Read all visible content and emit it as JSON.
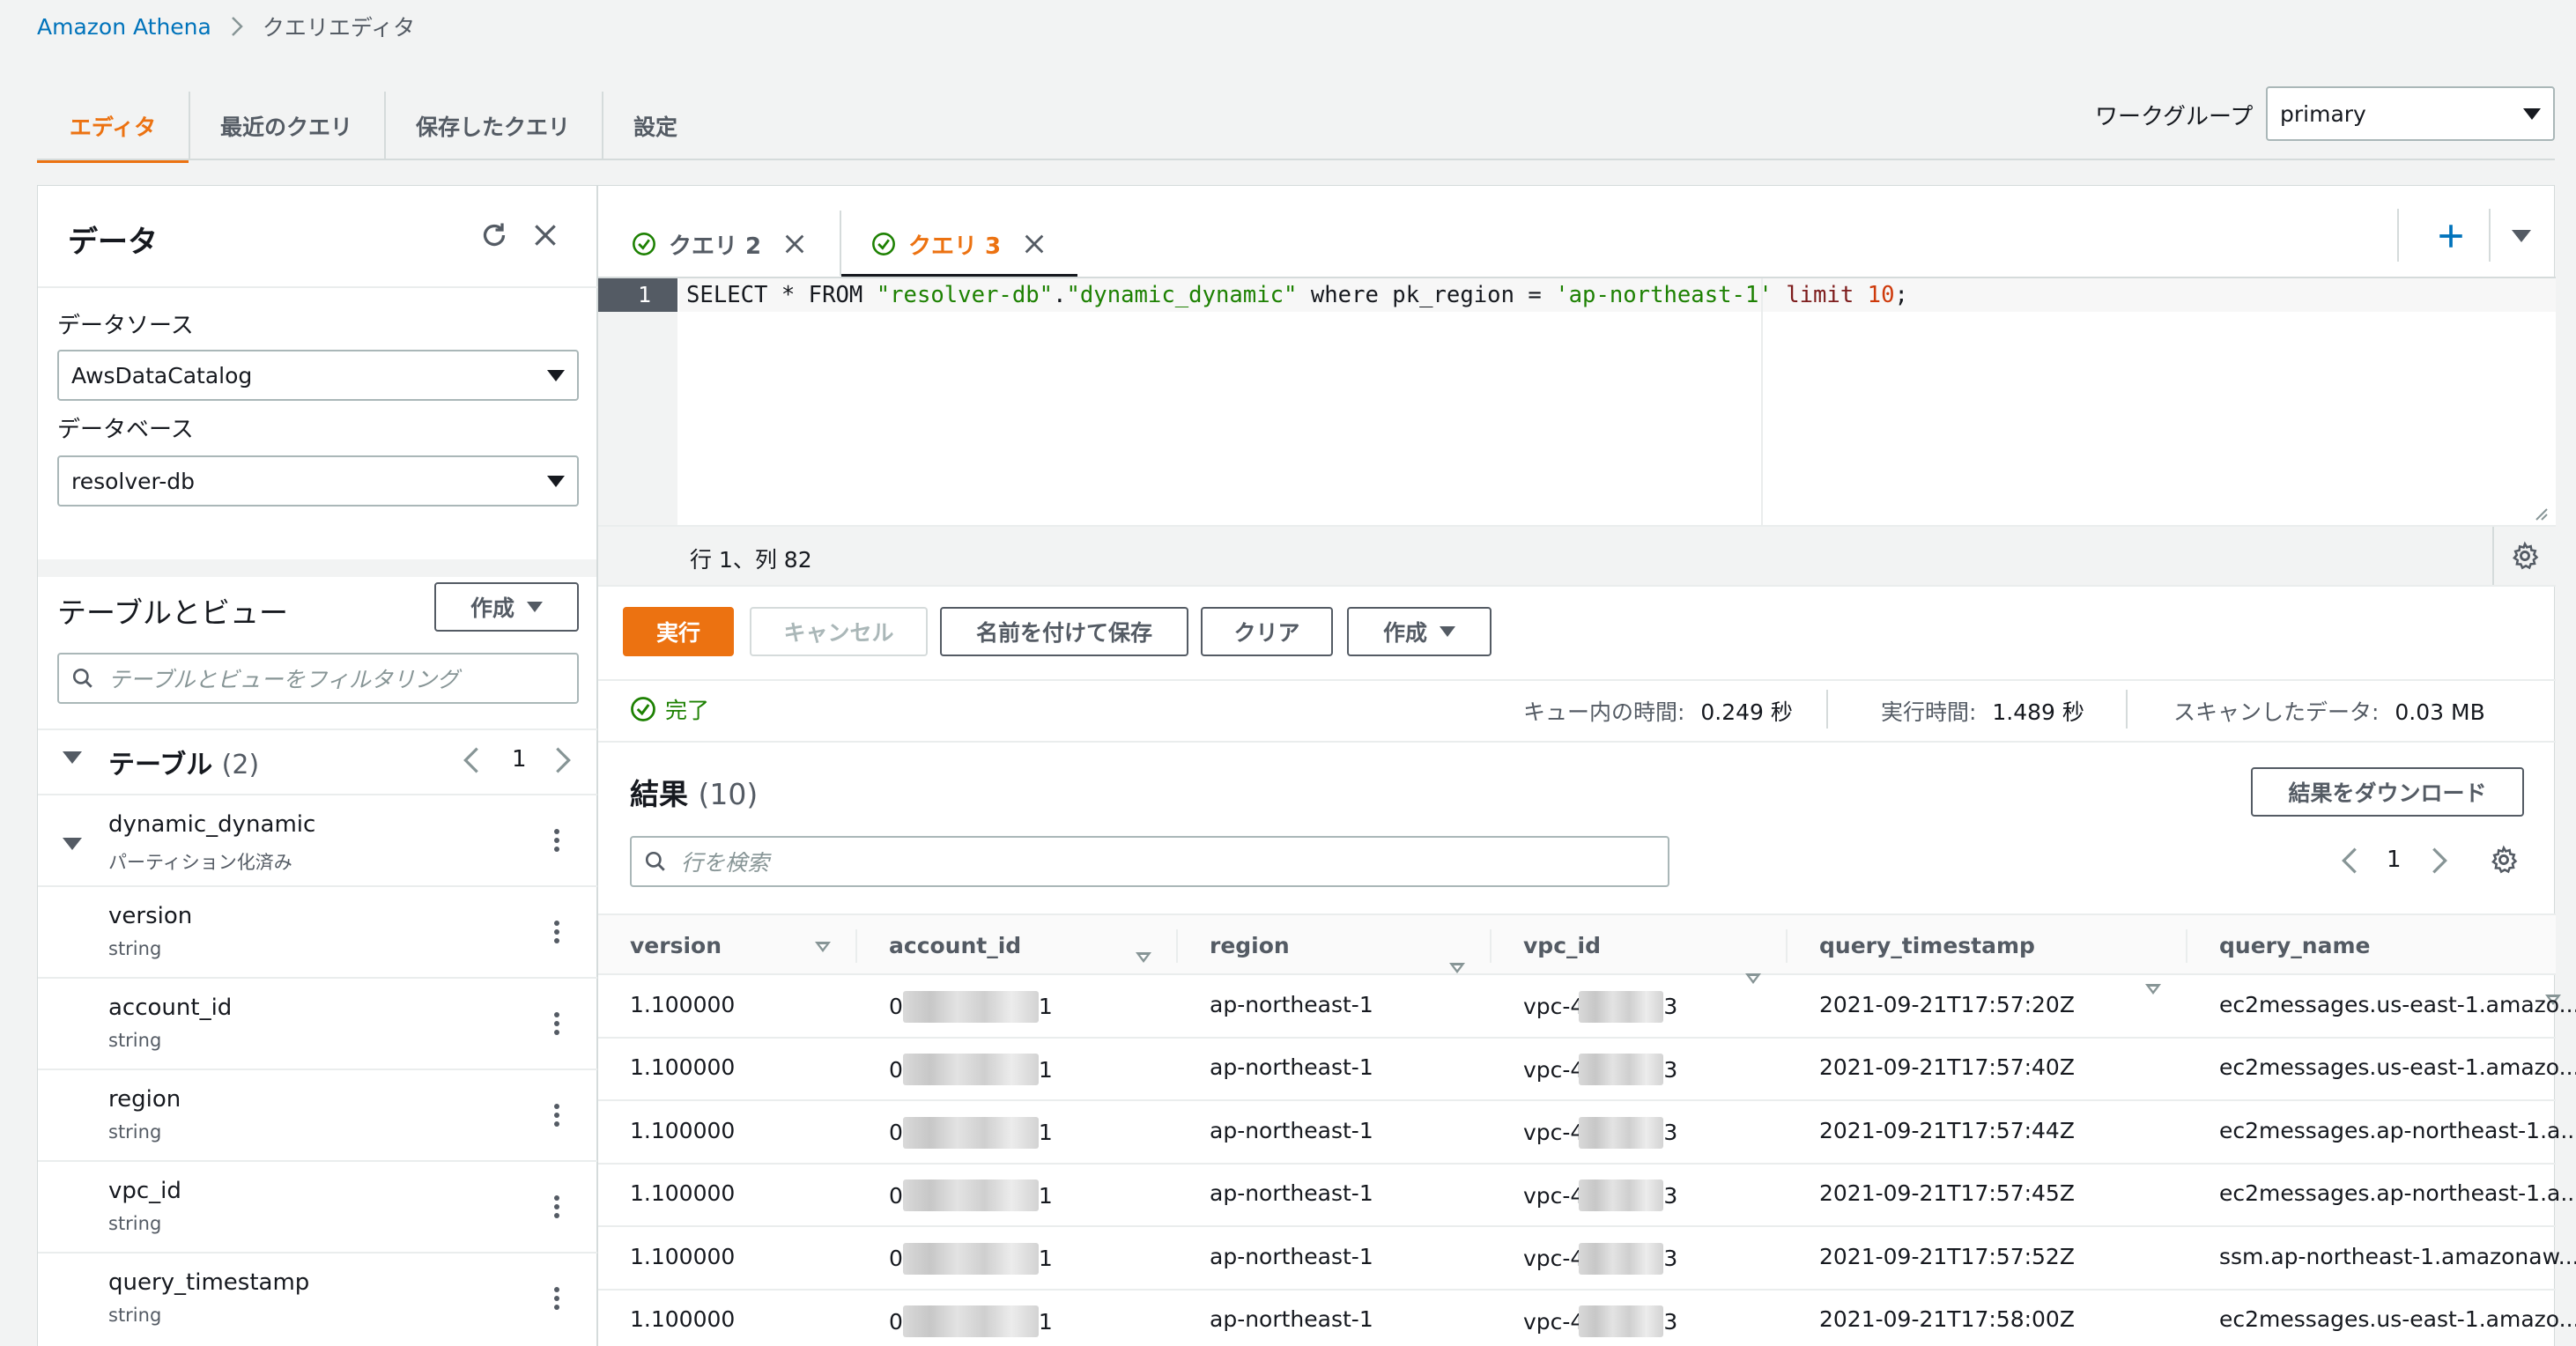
{
  "breadcrumb": {
    "root": "Amazon Athena",
    "current": "クエリエディタ"
  },
  "top_tabs": [
    {
      "label": "エディタ",
      "active": true
    },
    {
      "label": "最近のクエリ",
      "active": false
    },
    {
      "label": "保存したクエリ",
      "active": false
    },
    {
      "label": "設定",
      "active": false
    }
  ],
  "workgroup": {
    "label": "ワークグループ",
    "value": "primary"
  },
  "data_panel": {
    "title": "データ",
    "datasource_label": "データソース",
    "datasource_value": "AwsDataCatalog",
    "database_label": "データベース",
    "database_value": "resolver-db",
    "tables_views_title": "テーブルとビュー",
    "create_button": "作成",
    "filter_placeholder": "テーブルとビューをフィルタリング",
    "tables_label": "テーブル",
    "tables_count": "(2)",
    "page": "1",
    "table": {
      "name": "dynamic_dynamic",
      "note": "パーティション化済み"
    },
    "columns": [
      {
        "name": "version",
        "type": "string"
      },
      {
        "name": "account_id",
        "type": "string"
      },
      {
        "name": "region",
        "type": "string"
      },
      {
        "name": "vpc_id",
        "type": "string"
      },
      {
        "name": "query_timestamp",
        "type": "string"
      }
    ]
  },
  "query_tabs": [
    {
      "label": "クエリ 2",
      "active": false
    },
    {
      "label": "クエリ 3",
      "active": true
    }
  ],
  "editor": {
    "line_number": "1",
    "code": {
      "p1": "SELECT * FROM ",
      "s1": "\"resolver-db\"",
      "p2": ".",
      "s2": "\"dynamic_dynamic\"",
      "p3": " where pk_region = ",
      "s3": "'ap-northeast-1'",
      "p4": " ",
      "k1": "limit",
      "p5": " ",
      "n1": "10",
      "p6": ";"
    },
    "cursor_position": "行 1、列 82"
  },
  "actions": {
    "run": "実行",
    "cancel": "キャンセル",
    "save_as": "名前を付けて保存",
    "clear": "クリア",
    "create": "作成"
  },
  "status": {
    "state": "完了",
    "queue_label": "キュー内の時間:",
    "queue_value": "0.249 秒",
    "run_label": "実行時間:",
    "run_value": "1.489 秒",
    "scanned_label": "スキャンしたデータ:",
    "scanned_value": "0.03 MB"
  },
  "results": {
    "title": "結果",
    "count": "(10)",
    "download_button": "結果をダウンロード",
    "search_placeholder": "行を検索",
    "page": "1",
    "columns": [
      "version",
      "account_id",
      "region",
      "vpc_id",
      "query_timestamp",
      "query_name"
    ],
    "rows": [
      {
        "version": "1.100000",
        "account_id_start": "0",
        "account_id_end": "1",
        "region": "ap-northeast-1",
        "vpc_id_start": "vpc-4",
        "vpc_id_end": "3",
        "query_timestamp": "2021-09-21T17:57:20Z",
        "query_name": "ec2messages.us-east-1.amazo..."
      },
      {
        "version": "1.100000",
        "account_id_start": "0",
        "account_id_end": "1",
        "region": "ap-northeast-1",
        "vpc_id_start": "vpc-4",
        "vpc_id_end": "3",
        "query_timestamp": "2021-09-21T17:57:40Z",
        "query_name": "ec2messages.us-east-1.amazo..."
      },
      {
        "version": "1.100000",
        "account_id_start": "0",
        "account_id_end": "1",
        "region": "ap-northeast-1",
        "vpc_id_start": "vpc-4",
        "vpc_id_end": "3",
        "query_timestamp": "2021-09-21T17:57:44Z",
        "query_name": "ec2messages.ap-northeast-1.a..."
      },
      {
        "version": "1.100000",
        "account_id_start": "0",
        "account_id_end": "1",
        "region": "ap-northeast-1",
        "vpc_id_start": "vpc-4",
        "vpc_id_end": "3",
        "query_timestamp": "2021-09-21T17:57:45Z",
        "query_name": "ec2messages.ap-northeast-1.a..."
      },
      {
        "version": "1.100000",
        "account_id_start": "0",
        "account_id_end": "1",
        "region": "ap-northeast-1",
        "vpc_id_start": "vpc-4",
        "vpc_id_end": "3",
        "query_timestamp": "2021-09-21T17:57:52Z",
        "query_name": "ssm.ap-northeast-1.amazonaw..."
      },
      {
        "version": "1.100000",
        "account_id_start": "0",
        "account_id_end": "1",
        "region": "ap-northeast-1",
        "vpc_id_start": "vpc-4",
        "vpc_id_end": "3",
        "query_timestamp": "2021-09-21T17:58:00Z",
        "query_name": "ec2messages.us-east-1.amazo..."
      }
    ]
  },
  "colors": {
    "accent": "#ec7211",
    "link": "#0073bb",
    "success": "#1d8102",
    "string": "#1d8102",
    "number": "#ce3a0b"
  }
}
